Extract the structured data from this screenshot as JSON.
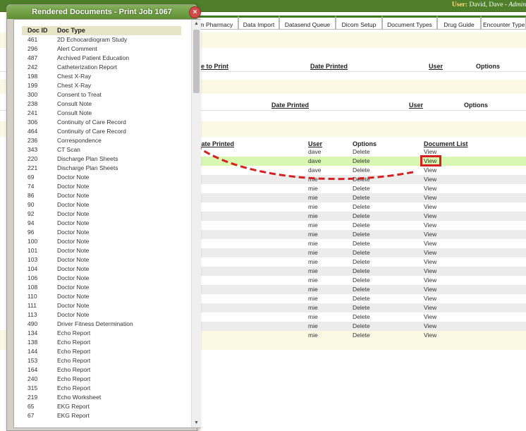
{
  "header": {
    "user_label": "User:",
    "user_name": "David, Dave",
    "user_role": "- Admin"
  },
  "tabs": [
    "om Pharmacy",
    "Data Import",
    "Datasend Queue",
    "Dicom Setup",
    "Document Types",
    "Drug Guide",
    "Encounter Type"
  ],
  "sections": {
    "print_headers": {
      "date_to_print": "ate to Print",
      "date_printed": "Date Printed",
      "user": "User",
      "options": "Options"
    },
    "second_headers": {
      "date_printed": "Date Printed",
      "user": "User",
      "options": "Options"
    },
    "doc_headers": {
      "date_printed": "Date Printed",
      "user": "User",
      "options": "Options",
      "document_list": "Document List"
    }
  },
  "doc_rows": [
    {
      "user": "dave",
      "option": "Delete",
      "view": "View"
    },
    {
      "user": "dave",
      "option": "Delete",
      "view": "View"
    },
    {
      "user": "dave",
      "option": "Delete",
      "view": "View"
    },
    {
      "user": "mie",
      "option": "Delete",
      "view": "View"
    },
    {
      "user": "mie",
      "option": "Delete",
      "view": "View"
    },
    {
      "user": "mie",
      "option": "Delete",
      "view": "View"
    },
    {
      "user": "mie",
      "option": "Delete",
      "view": "View"
    },
    {
      "user": "mie",
      "option": "Delete",
      "view": "View"
    },
    {
      "user": "mie",
      "option": "Delete",
      "view": "View"
    },
    {
      "user": "mie",
      "option": "Delete",
      "view": "View"
    },
    {
      "user": "mie",
      "option": "Delete",
      "view": "View"
    },
    {
      "user": "mie",
      "option": "Delete",
      "view": "View"
    },
    {
      "user": "mie",
      "option": "Delete",
      "view": "View"
    },
    {
      "user": "mie",
      "option": "Delete",
      "view": "View"
    },
    {
      "user": "mie",
      "option": "Delete",
      "view": "View"
    },
    {
      "user": "mie",
      "option": "Delete",
      "view": "View"
    },
    {
      "user": "mie",
      "option": "Delete",
      "view": "View"
    },
    {
      "user": "mie",
      "option": "Delete",
      "view": "View"
    },
    {
      "user": "mie",
      "option": "Delete",
      "view": "View"
    },
    {
      "user": "mie",
      "option": "Delete",
      "view": "View"
    },
    {
      "user": "mie",
      "option": "Delete",
      "view": "View"
    }
  ],
  "popup": {
    "title": "Rendered Documents - Print Job 1067",
    "close_glyph": "×",
    "col_id": "Doc ID",
    "col_type": "Doc Type",
    "items": [
      {
        "id": "461",
        "type": "2D Echocardiogram Study"
      },
      {
        "id": "296",
        "type": "Alert Comment"
      },
      {
        "id": "487",
        "type": "Archived Patient Education"
      },
      {
        "id": "242",
        "type": "Catheterization Report"
      },
      {
        "id": "198",
        "type": "Chest X-Ray"
      },
      {
        "id": "199",
        "type": "Chest X-Ray"
      },
      {
        "id": "300",
        "type": "Consent to Treat"
      },
      {
        "id": "238",
        "type": "Consult Note"
      },
      {
        "id": "241",
        "type": "Consult Note"
      },
      {
        "id": "306",
        "type": "Continuity of Care Record"
      },
      {
        "id": "464",
        "type": "Continuity of Care Record"
      },
      {
        "id": "236",
        "type": "Correspondence"
      },
      {
        "id": "343",
        "type": "CT Scan"
      },
      {
        "id": "220",
        "type": "Discharge Plan Sheets"
      },
      {
        "id": "221",
        "type": "Discharge Plan Sheets"
      },
      {
        "id": "69",
        "type": "Doctor Note"
      },
      {
        "id": "74",
        "type": "Doctor Note"
      },
      {
        "id": "86",
        "type": "Doctor Note"
      },
      {
        "id": "90",
        "type": "Doctor Note"
      },
      {
        "id": "92",
        "type": "Doctor Note"
      },
      {
        "id": "94",
        "type": "Doctor Note"
      },
      {
        "id": "96",
        "type": "Doctor Note"
      },
      {
        "id": "100",
        "type": "Doctor Note"
      },
      {
        "id": "101",
        "type": "Doctor Note"
      },
      {
        "id": "103",
        "type": "Doctor Note"
      },
      {
        "id": "104",
        "type": "Doctor Note"
      },
      {
        "id": "106",
        "type": "Doctor Note"
      },
      {
        "id": "108",
        "type": "Doctor Note"
      },
      {
        "id": "110",
        "type": "Doctor Note"
      },
      {
        "id": "111",
        "type": "Doctor Note"
      },
      {
        "id": "113",
        "type": "Doctor Note"
      },
      {
        "id": "490",
        "type": "Driver Fitness Determination"
      },
      {
        "id": "134",
        "type": "Echo Report"
      },
      {
        "id": "138",
        "type": "Echo Report"
      },
      {
        "id": "144",
        "type": "Echo Report"
      },
      {
        "id": "153",
        "type": "Echo Report"
      },
      {
        "id": "164",
        "type": "Echo Report"
      },
      {
        "id": "240",
        "type": "Echo Report"
      },
      {
        "id": "315",
        "type": "Echo Report"
      },
      {
        "id": "219",
        "type": "Echo Worksheet"
      },
      {
        "id": "65",
        "type": "EKG Report"
      },
      {
        "id": "67",
        "type": "EKG Report"
      }
    ]
  },
  "colors": {
    "topbar": "#4f7f2a",
    "tab_accent": "#3f7a1f",
    "selected_row": "#d8f7b0",
    "annotation_red": "#d42020"
  }
}
